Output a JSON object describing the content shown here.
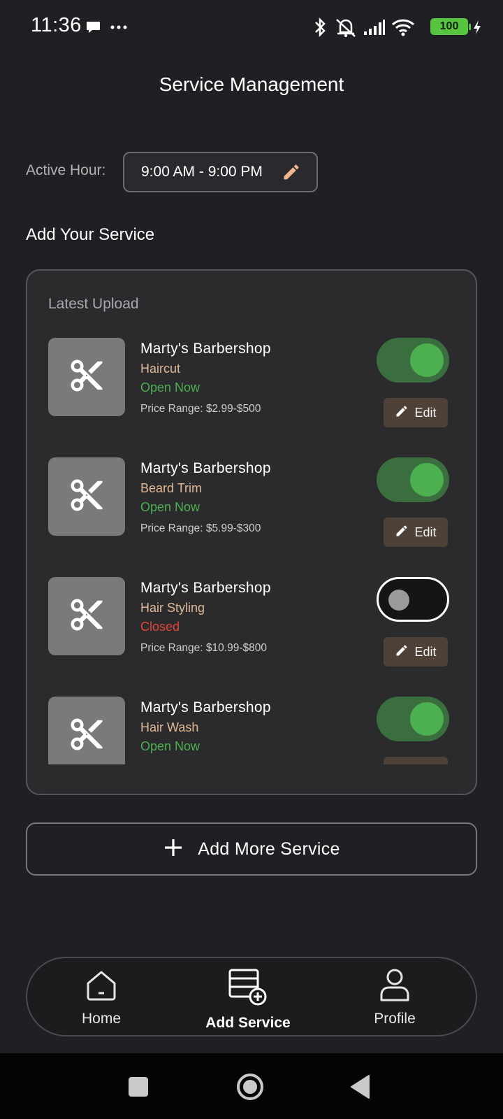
{
  "status_bar": {
    "time": "11:36",
    "battery": "100",
    "icons": [
      "chat-bubble-icon",
      "more-dots-icon",
      "bluetooth-icon",
      "mute-icon",
      "signal-icon",
      "wifi-icon",
      "battery-icon",
      "charging-icon"
    ]
  },
  "page": {
    "title": "Service Management"
  },
  "active_hour": {
    "label": "Active Hour:",
    "value": "9:00 AM - 9:00 PM"
  },
  "section_title": "Add Your Service",
  "card": {
    "label": "Latest Upload"
  },
  "services": [
    {
      "name": "Marty's Barbershop",
      "type": "Haircut",
      "status": "Open Now",
      "status_kind": "open",
      "price": "Price Range: $2.99-$500",
      "enabled": true,
      "edit_label": "Edit"
    },
    {
      "name": "Marty's Barbershop",
      "type": "Beard Trim",
      "status": "Open Now",
      "status_kind": "open",
      "price": "Price Range: $5.99-$300",
      "enabled": true,
      "edit_label": "Edit"
    },
    {
      "name": "Marty's Barbershop",
      "type": "Hair Styling",
      "status": "Closed",
      "status_kind": "closed",
      "price": "Price Range: $10.99-$800",
      "enabled": false,
      "edit_label": "Edit"
    },
    {
      "name": "Marty's Barbershop",
      "type": "Hair Wash",
      "status": "Open Now",
      "status_kind": "open",
      "price": "",
      "enabled": true,
      "edit_label": ""
    }
  ],
  "add_more": {
    "label": "Add More Service"
  },
  "bottom_nav": {
    "items": [
      {
        "label": "Home",
        "icon": "home-icon",
        "active": false
      },
      {
        "label": "Add Service",
        "icon": "add-service-icon",
        "active": true
      },
      {
        "label": "Profile",
        "icon": "profile-icon",
        "active": false
      }
    ]
  },
  "colors": {
    "background": "#1f2024",
    "card": "#2b2b2e",
    "open_status": "#4caf50",
    "closed_status": "#e5443a",
    "service_type": "#e0b893",
    "toggle_on": "#4cb050",
    "edit_button": "#4e4138"
  }
}
